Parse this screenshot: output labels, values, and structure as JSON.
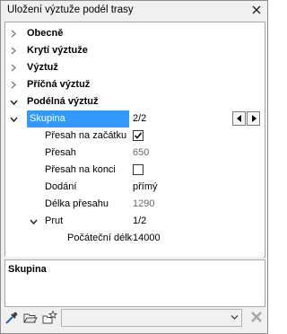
{
  "window": {
    "title": "Uložení výztuže podél trasy"
  },
  "categories": [
    {
      "label": "Obecně",
      "expanded": false
    },
    {
      "label": "Krytí výztuže",
      "expanded": false
    },
    {
      "label": "Výztuž",
      "expanded": false
    },
    {
      "label": "Příčná výztuž",
      "expanded": false
    },
    {
      "label": "Podélná výztuž",
      "expanded": true
    }
  ],
  "group": {
    "label": "Skupina",
    "value": "2/2",
    "selected": true
  },
  "properties": [
    {
      "label": "Přesah na začátku",
      "value_type": "checkbox",
      "checked": true
    },
    {
      "label": "Přesah",
      "value": "650",
      "value_readonly": true
    },
    {
      "label": "Přesah na konci",
      "value_type": "checkbox",
      "checked": false
    },
    {
      "label": "Dodání",
      "value": "přímý"
    },
    {
      "label": "Délka přesahu",
      "value": "1290",
      "value_readonly": true
    }
  ],
  "subgroup": {
    "label": "Prut",
    "value": "1/2"
  },
  "subproperties": [
    {
      "label": "Počáteční délka",
      "value": "14000"
    }
  ],
  "description": {
    "title": "Skupina"
  },
  "toolbar": {
    "combo_value": ""
  },
  "colors": {
    "selection": "#3399ff",
    "border": "#a8a8a8",
    "chrome": "#f0f0f0"
  }
}
